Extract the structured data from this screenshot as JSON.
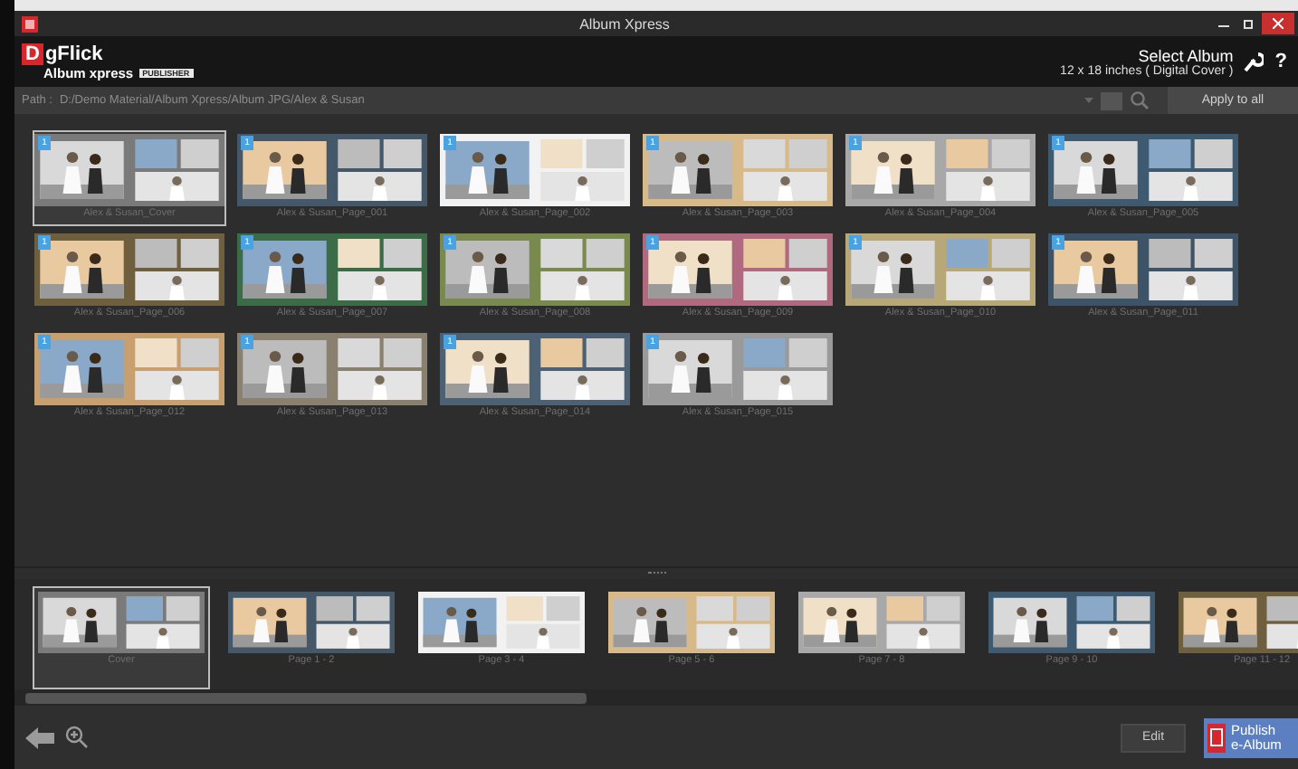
{
  "window": {
    "title": "Album Xpress"
  },
  "header": {
    "brand_mark": "D",
    "brand": "gFlick",
    "product": "Album xpress",
    "edition": "PUBLISHER",
    "select_label": "Select Album",
    "album_size": "12 x 18 inches ( Digital Cover )",
    "help": "?"
  },
  "path_bar": {
    "label": "Path :",
    "value": "D:/Demo Material/Album Xpress/Album JPG/Alex & Susan",
    "apply_button": "Apply to all"
  },
  "grid": {
    "items": [
      {
        "label": "Alex & Susan_Cover",
        "badge": "1",
        "selected": true
      },
      {
        "label": "Alex & Susan_Page_001",
        "badge": "1",
        "selected": false
      },
      {
        "label": "Alex & Susan_Page_002",
        "badge": "1",
        "selected": false
      },
      {
        "label": "Alex & Susan_Page_003",
        "badge": "1",
        "selected": false
      },
      {
        "label": "Alex & Susan_Page_004",
        "badge": "1",
        "selected": false
      },
      {
        "label": "Alex & Susan_Page_005",
        "badge": "1",
        "selected": false
      },
      {
        "label": "Alex & Susan_Page_006",
        "badge": "1",
        "selected": false
      },
      {
        "label": "Alex & Susan_Page_007",
        "badge": "1",
        "selected": false
      },
      {
        "label": "Alex & Susan_Page_008",
        "badge": "1",
        "selected": false
      },
      {
        "label": "Alex & Susan_Page_009",
        "badge": "1",
        "selected": false
      },
      {
        "label": "Alex & Susan_Page_010",
        "badge": "1",
        "selected": false
      },
      {
        "label": "Alex & Susan_Page_011",
        "badge": "1",
        "selected": false
      },
      {
        "label": "Alex & Susan_Page_012",
        "badge": "1",
        "selected": false
      },
      {
        "label": "Alex & Susan_Page_013",
        "badge": "1",
        "selected": false
      },
      {
        "label": "Alex & Susan_Page_014",
        "badge": "1",
        "selected": false
      },
      {
        "label": "Alex & Susan_Page_015",
        "badge": "1",
        "selected": false
      }
    ]
  },
  "filmstrip": {
    "items": [
      {
        "label": "Cover",
        "selected": true
      },
      {
        "label": "Page 1 - 2",
        "selected": false
      },
      {
        "label": "Page 3 - 4",
        "selected": false
      },
      {
        "label": "Page 5 - 6",
        "selected": false
      },
      {
        "label": "Page 7 - 8",
        "selected": false
      },
      {
        "label": "Page 9 - 10",
        "selected": false
      },
      {
        "label": "Page 11 - 12",
        "selected": false
      }
    ]
  },
  "bottom_bar": {
    "edit_button": "Edit",
    "publish_button": "Publish e-Album"
  }
}
